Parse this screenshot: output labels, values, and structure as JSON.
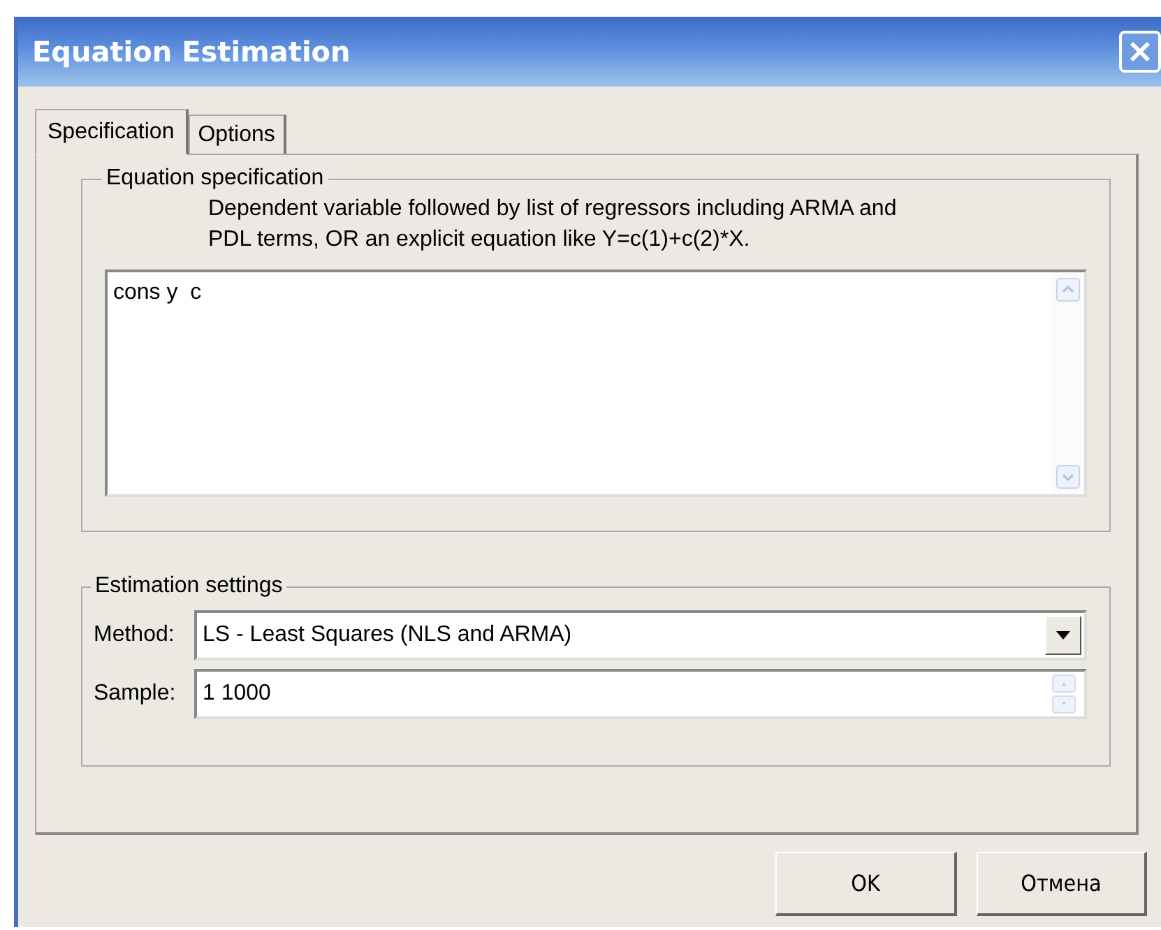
{
  "window": {
    "title": "Equation Estimation"
  },
  "tabs": [
    {
      "label": "Specification",
      "selected": true
    },
    {
      "label": "Options",
      "selected": false
    }
  ],
  "equation_specification": {
    "legend": "Equation specification",
    "hint": "Dependent variable followed by list of regressors including ARMA and PDL terms, OR an explicit equation like Y=c(1)+c(2)*X.",
    "value": "cons y  c"
  },
  "estimation_settings": {
    "legend": "Estimation settings",
    "method_label": "Method:",
    "method_value": "LS  -  Least Squares (NLS and ARMA)",
    "sample_label": "Sample:",
    "sample_value": "1 1000"
  },
  "buttons": [
    "OK",
    "Отмена"
  ]
}
